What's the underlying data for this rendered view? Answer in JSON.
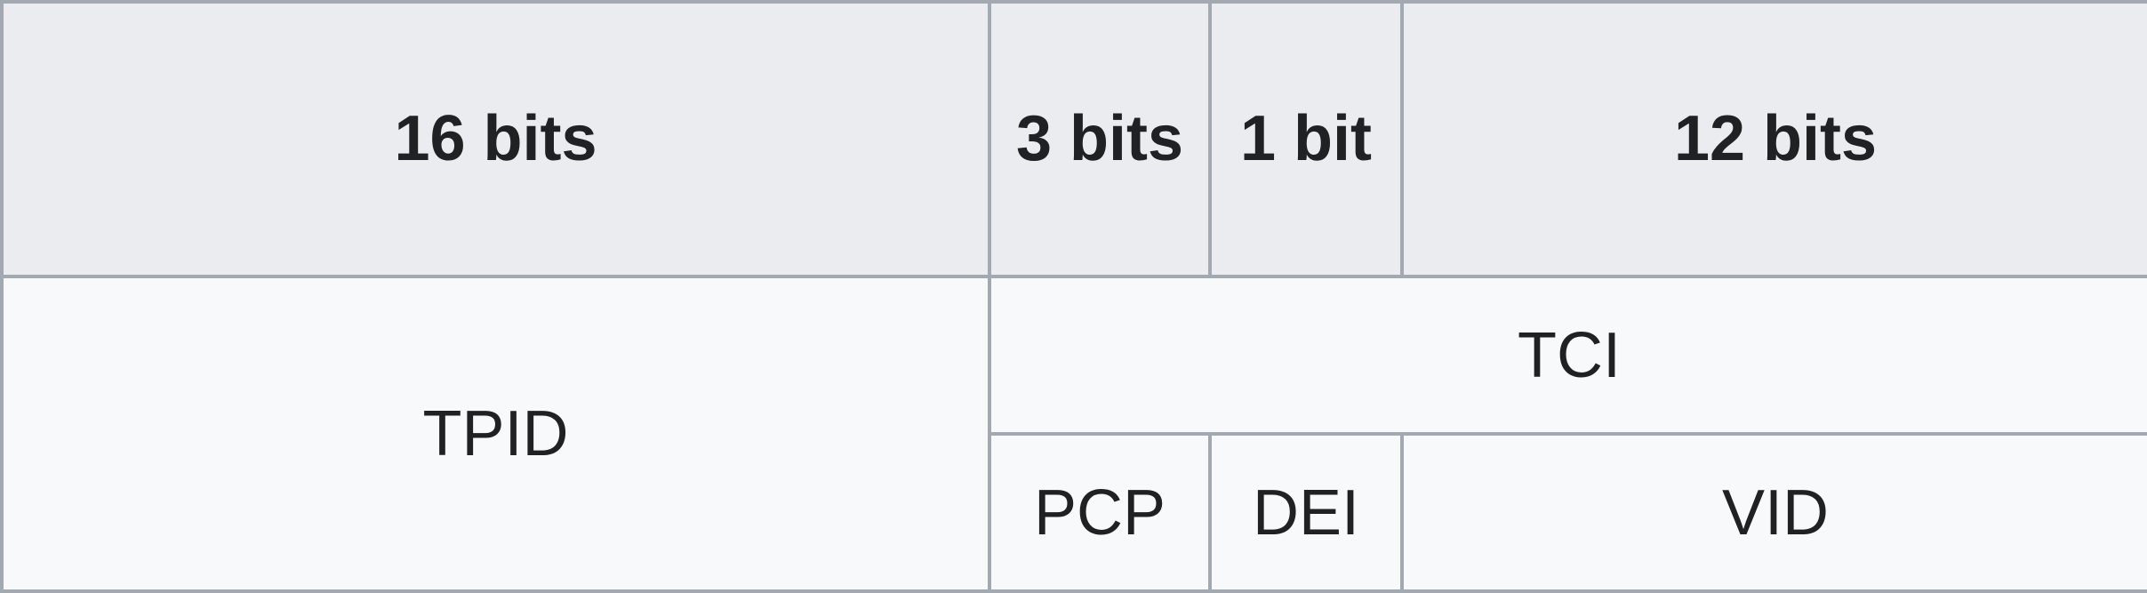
{
  "header": {
    "tpid_size": "16 bits",
    "pcp_size": "3 bits",
    "dei_size": "1 bit",
    "vid_size": "12 bits"
  },
  "fields": {
    "tpid": "TPID",
    "tci": "TCI",
    "pcp": "PCP",
    "dei": "DEI",
    "vid": "VID"
  },
  "colors": {
    "header_bg": "#eaecf0",
    "cell_bg": "#f8f9fa",
    "border": "#a2a9b1",
    "text": "#202122"
  }
}
